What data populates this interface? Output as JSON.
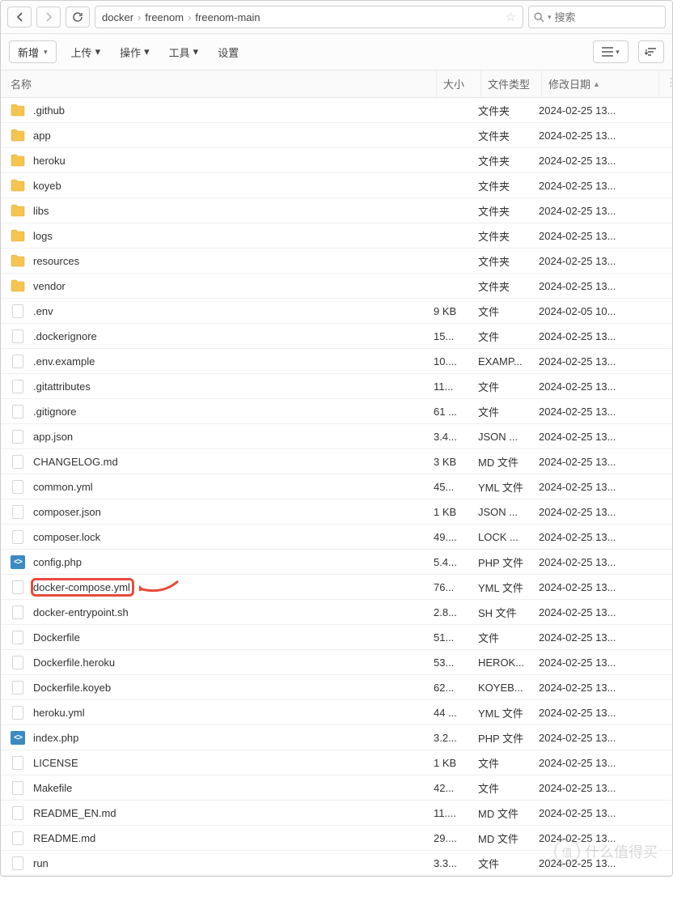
{
  "breadcrumb": [
    "docker",
    "freenom",
    "freenom-main"
  ],
  "search": {
    "placeholder": "搜索"
  },
  "toolbar": {
    "new": "新增",
    "upload": "上传",
    "action": "操作",
    "tool": "工具",
    "settings": "设置"
  },
  "columns": {
    "name": "名称",
    "size": "大小",
    "type": "文件类型",
    "date": "修改日期",
    "sort_indicator": "▲"
  },
  "type_labels": {
    "folder": "文件夹",
    "file": "文件"
  },
  "files": [
    {
      "name": ".github",
      "size": "",
      "type": "文件夹",
      "date": "2024-02-25 13...",
      "icon": "folder"
    },
    {
      "name": "app",
      "size": "",
      "type": "文件夹",
      "date": "2024-02-25 13...",
      "icon": "folder"
    },
    {
      "name": "heroku",
      "size": "",
      "type": "文件夹",
      "date": "2024-02-25 13...",
      "icon": "folder"
    },
    {
      "name": "koyeb",
      "size": "",
      "type": "文件夹",
      "date": "2024-02-25 13...",
      "icon": "folder"
    },
    {
      "name": "libs",
      "size": "",
      "type": "文件夹",
      "date": "2024-02-25 13...",
      "icon": "folder"
    },
    {
      "name": "logs",
      "size": "",
      "type": "文件夹",
      "date": "2024-02-25 13...",
      "icon": "folder"
    },
    {
      "name": "resources",
      "size": "",
      "type": "文件夹",
      "date": "2024-02-25 13...",
      "icon": "folder"
    },
    {
      "name": "vendor",
      "size": "",
      "type": "文件夹",
      "date": "2024-02-25 13...",
      "icon": "folder"
    },
    {
      "name": ".env",
      "size": "9 KB",
      "type": "文件",
      "date": "2024-02-05 10...",
      "icon": "file"
    },
    {
      "name": ".dockerignore",
      "size": "15...",
      "type": "文件",
      "date": "2024-02-25 13...",
      "icon": "file"
    },
    {
      "name": ".env.example",
      "size": "10....",
      "type": "EXAMP...",
      "date": "2024-02-25 13...",
      "icon": "file"
    },
    {
      "name": ".gitattributes",
      "size": "11...",
      "type": "文件",
      "date": "2024-02-25 13...",
      "icon": "file"
    },
    {
      "name": ".gitignore",
      "size": "61 ...",
      "type": "文件",
      "date": "2024-02-25 13...",
      "icon": "file"
    },
    {
      "name": "app.json",
      "size": "3.4...",
      "type": "JSON ...",
      "date": "2024-02-25 13...",
      "icon": "file"
    },
    {
      "name": "CHANGELOG.md",
      "size": "3 KB",
      "type": "MD 文件",
      "date": "2024-02-25 13...",
      "icon": "file"
    },
    {
      "name": "common.yml",
      "size": "45...",
      "type": "YML 文件",
      "date": "2024-02-25 13...",
      "icon": "file"
    },
    {
      "name": "composer.json",
      "size": "1 KB",
      "type": "JSON ...",
      "date": "2024-02-25 13...",
      "icon": "file"
    },
    {
      "name": "composer.lock",
      "size": "49....",
      "type": "LOCK ...",
      "date": "2024-02-25 13...",
      "icon": "file"
    },
    {
      "name": "config.php",
      "size": "5.4...",
      "type": "PHP 文件",
      "date": "2024-02-25 13...",
      "icon": "code"
    },
    {
      "name": "docker-compose.yml",
      "size": "76...",
      "type": "YML 文件",
      "date": "2024-02-25 13...",
      "icon": "file",
      "highlight": true
    },
    {
      "name": "docker-entrypoint.sh",
      "size": "2.8...",
      "type": "SH 文件",
      "date": "2024-02-25 13...",
      "icon": "file"
    },
    {
      "name": "Dockerfile",
      "size": "51...",
      "type": "文件",
      "date": "2024-02-25 13...",
      "icon": "file"
    },
    {
      "name": "Dockerfile.heroku",
      "size": "53...",
      "type": "HEROK...",
      "date": "2024-02-25 13...",
      "icon": "file"
    },
    {
      "name": "Dockerfile.koyeb",
      "size": "62...",
      "type": "KOYEB...",
      "date": "2024-02-25 13...",
      "icon": "file"
    },
    {
      "name": "heroku.yml",
      "size": "44 ...",
      "type": "YML 文件",
      "date": "2024-02-25 13...",
      "icon": "file"
    },
    {
      "name": "index.php",
      "size": "3.2...",
      "type": "PHP 文件",
      "date": "2024-02-25 13...",
      "icon": "code"
    },
    {
      "name": "LICENSE",
      "size": "1 KB",
      "type": "文件",
      "date": "2024-02-25 13...",
      "icon": "file"
    },
    {
      "name": "Makefile",
      "size": "42...",
      "type": "文件",
      "date": "2024-02-25 13...",
      "icon": "file"
    },
    {
      "name": "README_EN.md",
      "size": "11....",
      "type": "MD 文件",
      "date": "2024-02-25 13...",
      "icon": "file"
    },
    {
      "name": "README.md",
      "size": "29....",
      "type": "MD 文件",
      "date": "2024-02-25 13...",
      "icon": "file"
    },
    {
      "name": "run",
      "size": "3.3...",
      "type": "文件",
      "date": "2024-02-25 13...",
      "icon": "file"
    }
  ],
  "watermark": {
    "badge": "值",
    "text": "什么值得买"
  }
}
